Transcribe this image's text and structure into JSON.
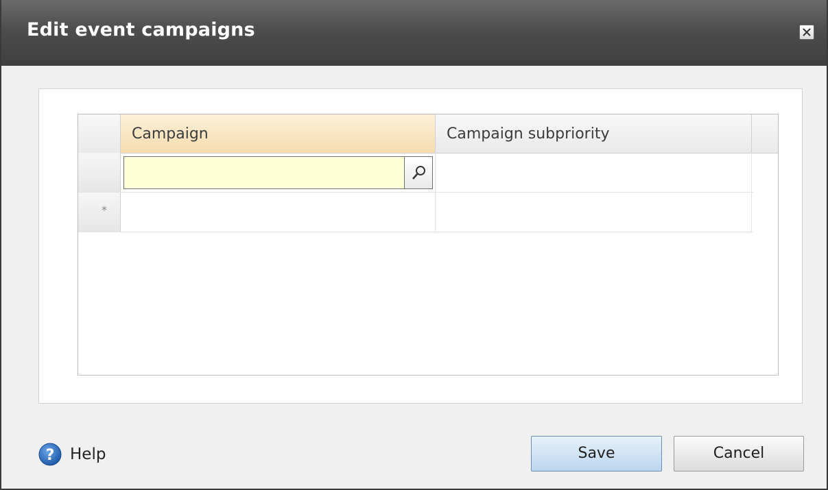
{
  "dialog": {
    "title": "Edit event campaigns"
  },
  "grid": {
    "columns": [
      "Campaign",
      "Campaign subpriority"
    ],
    "rows": [
      {
        "marker": "",
        "campaign": "",
        "subpriority": ""
      },
      {
        "marker": "*",
        "campaign": "",
        "subpriority": ""
      }
    ]
  },
  "footer": {
    "help_label": "Help",
    "save_label": "Save",
    "cancel_label": "Cancel"
  },
  "colors": {
    "titlebar": "#4d4d4d",
    "active_header": "#f6dcae",
    "input_bg": "#ffffd8",
    "save_button": "#bcd6ef",
    "help_icon": "#2f6ec0"
  },
  "icons": {
    "close": "close-icon",
    "search": "search-icon",
    "help": "help-icon"
  }
}
